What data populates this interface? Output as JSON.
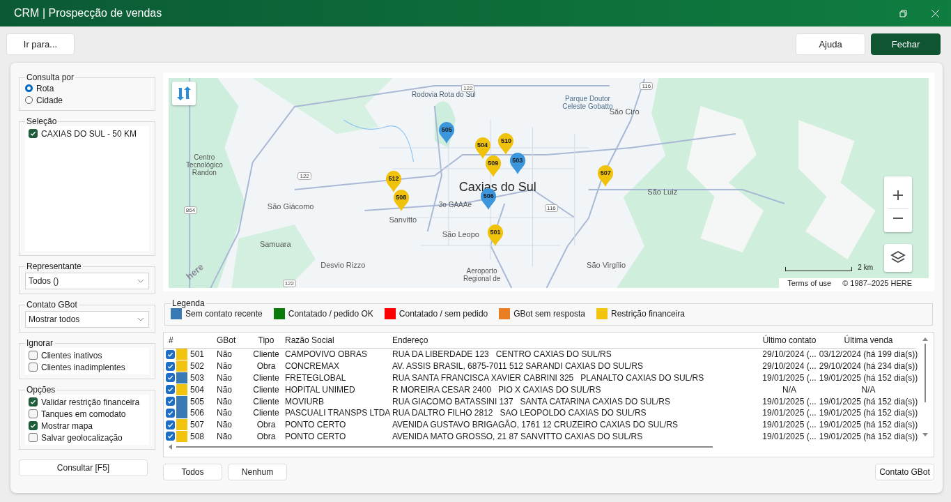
{
  "window": {
    "title": "CRM | Prospecção de vendas"
  },
  "toolbar": {
    "goto": "Ir para...",
    "help": "Ajuda",
    "close": "Fechar"
  },
  "consulta": {
    "title": "Consulta por",
    "options": [
      {
        "label": "Rota",
        "selected": true
      },
      {
        "label": "Cidade",
        "selected": false
      }
    ]
  },
  "selecao": {
    "title": "Seleção",
    "items": [
      {
        "label": "CAXIAS DO SUL - 50 KM",
        "checked": true
      }
    ]
  },
  "representante": {
    "title": "Representante",
    "value": "Todos ()"
  },
  "contato_gbot": {
    "title": "Contato GBot",
    "value": "Mostrar todos"
  },
  "ignorar": {
    "title": "Ignorar",
    "items": [
      {
        "label": "Clientes inativos",
        "checked": false
      },
      {
        "label": "Clientes inadimplentes",
        "checked": false
      }
    ]
  },
  "opcoes": {
    "title": "Opções",
    "items": [
      {
        "label": "Validar restrição financeira",
        "checked": true
      },
      {
        "label": "Tanques em comodato",
        "checked": false
      },
      {
        "label": "Mostrar mapa",
        "checked": true
      },
      {
        "label": "Salvar geolocalização",
        "checked": false
      }
    ]
  },
  "consultar_button": "Consultar [F5]",
  "map": {
    "labels": [
      {
        "text": "Rodovia Rota do Sul",
        "kind": "road"
      },
      {
        "text": "Parque Doutor Celeste Gobatto",
        "kind": "park"
      },
      {
        "text": "São Ciro",
        "kind": "place"
      },
      {
        "text": "Centro Tecnológico Randon",
        "kind": "small"
      },
      {
        "text": "Caxias do Sul",
        "kind": "city"
      },
      {
        "text": "São Luiz",
        "kind": "place"
      },
      {
        "text": "São Giácomo",
        "kind": "place"
      },
      {
        "text": "3o GAAAe",
        "kind": "small"
      },
      {
        "text": "Sanvitto",
        "kind": "place"
      },
      {
        "text": "São Leopo",
        "kind": "place"
      },
      {
        "text": "Samuara",
        "kind": "place"
      },
      {
        "text": "Desvio Rizzo",
        "kind": "place"
      },
      {
        "text": "Aeroporto Regional de",
        "kind": "small"
      },
      {
        "text": "São Virgílio",
        "kind": "place"
      }
    ],
    "shields": [
      "122",
      "116",
      "122",
      "864",
      "116",
      "122"
    ],
    "pins": [
      {
        "label": "505",
        "color": "#3b96db"
      },
      {
        "label": "504",
        "color": "#f0c20c"
      },
      {
        "label": "510",
        "color": "#f0c20c"
      },
      {
        "label": "509",
        "color": "#f0c20c"
      },
      {
        "label": "503",
        "color": "#3b96db"
      },
      {
        "label": "507",
        "color": "#f0c20c"
      },
      {
        "label": "512",
        "color": "#f0c20c"
      },
      {
        "label": "508",
        "color": "#f0c20c"
      },
      {
        "label": "506",
        "color": "#3b96db"
      },
      {
        "label": "501",
        "color": "#f0c20c"
      }
    ],
    "logo": "here",
    "scale": "2 km",
    "terms": "Terms of use",
    "copyright": "© 1987–2025 HERE"
  },
  "legend": {
    "title": "Legenda",
    "items": [
      {
        "label": "Sem contato recente",
        "color": "#3a7ab4"
      },
      {
        "label": "Contatado / pedido OK",
        "color": "#0a7a0a"
      },
      {
        "label": "Contatado / sem pedido",
        "color": "#ff0000"
      },
      {
        "label": "GBot sem resposta",
        "color": "#e87f22"
      },
      {
        "label": "Restrição financeira",
        "color": "#f3c40f"
      }
    ]
  },
  "table": {
    "columns": [
      "#",
      "GBot",
      "Tipo",
      "Razão Social",
      "Endereço",
      "Último contato",
      "Última venda"
    ],
    "rows": [
      {
        "checked": true,
        "color": "#f3c40f",
        "cells": [
          "501",
          "Não",
          "Cliente",
          "CAMPOVIVO OBRAS",
          "RUA DA LIBERDADE 123   CENTRO CAXIAS DO SUL/RS",
          "29/10/2024 (...",
          "03/12/2024 (há 199 dia(s))"
        ]
      },
      {
        "checked": true,
        "color": "#f3c40f",
        "cells": [
          "502",
          "Não",
          "Obra",
          "CONCREMAX",
          "AV. ASSIS BRASIL, 6875-7011 512 SARANDI CAXIAS DO SUL/RS",
          "29/10/2024 (...",
          "29/10/2024 (há 234 dia(s))"
        ]
      },
      {
        "checked": true,
        "color": "#3a7ab4",
        "cells": [
          "503",
          "Não",
          "Cliente",
          "FRETEGLOBAL",
          "RUA SANTA FRANCISCA XAVIER CABRINI 325   PLANALTO CAXIAS DO SUL/RS",
          "19/01/2025 (...",
          "19/01/2025 (há 152 dia(s))"
        ]
      },
      {
        "checked": true,
        "color": "#f3c40f",
        "cells": [
          "504",
          "Não",
          "Cliente",
          "HOPITAL UNIMED",
          "R MOREIRA CESAR 2400   PIO X CAXIAS DO SUL/RS",
          "N/A",
          "N/A"
        ]
      },
      {
        "checked": true,
        "color": "#3a7ab4",
        "cells": [
          "505",
          "Não",
          "Cliente",
          "MOVIURB",
          "RUA GIACOMO BATASSINI 137   SANTA CATARINA CAXIAS DO SUL/RS",
          "19/01/2025 (...",
          "19/01/2025 (há 152 dia(s))"
        ]
      },
      {
        "checked": true,
        "color": "#3a7ab4",
        "cells": [
          "506",
          "Não",
          "Cliente",
          "PASCUALI TRANSPS LTDA",
          "RUA DALTRO FILHO 2812   SAO LEOPOLDO CAXIAS DO SUL/RS",
          "19/01/2025 (...",
          "19/01/2025 (há 152 dia(s))"
        ]
      },
      {
        "checked": true,
        "color": "#f3c40f",
        "cells": [
          "507",
          "Não",
          "Obra",
          "PONTO CERTO",
          "AVENIDA GUSTAVO BRIGAGÃO, 1761 12 CRUZEIRO CAXIAS DO SUL/RS",
          "19/01/2025 (...",
          "19/01/2025 (há 152 dia(s))"
        ]
      },
      {
        "checked": true,
        "color": "#f3c40f",
        "cells": [
          "508",
          "Não",
          "Obra",
          "PONTO CERTO",
          "AVENIDA MATO GROSSO, 21 87 SANVITTO CAXIAS DO SUL/RS",
          "19/01/2025 (...",
          "19/01/2025 (há 152 dia(s))"
        ]
      }
    ]
  },
  "bottom": {
    "all": "Todos",
    "none": "Nenhum",
    "gbot": "Contato GBot"
  }
}
